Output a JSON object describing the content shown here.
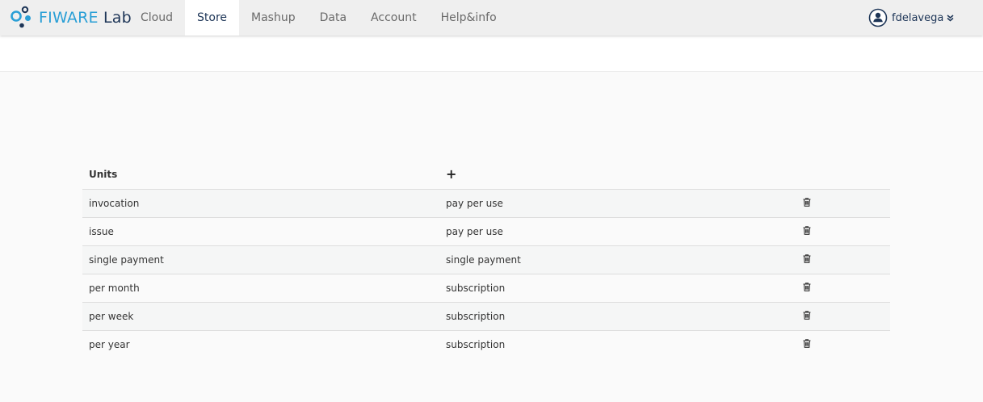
{
  "brand": {
    "name_part1": "FI",
    "name_part2": "WARE",
    "name_part3": " Lab",
    "icon": "fiware-logo-icon"
  },
  "nav": {
    "tabs": [
      {
        "label": "Cloud",
        "active": false
      },
      {
        "label": "Store",
        "active": true
      },
      {
        "label": "Mashup",
        "active": false
      },
      {
        "label": "Data",
        "active": false
      },
      {
        "label": "Account",
        "active": false
      },
      {
        "label": "Help&info",
        "active": false
      }
    ]
  },
  "user": {
    "name": "fdelavega",
    "icon": "user-circle-icon",
    "chevron": "double-chevron-down-icon"
  },
  "table": {
    "header_units": "Units",
    "add_label": "+",
    "rows": [
      {
        "unit": "invocation",
        "model": "pay per use"
      },
      {
        "unit": "issue",
        "model": "pay per use"
      },
      {
        "unit": "single payment",
        "model": "single payment"
      },
      {
        "unit": "per month",
        "model": "subscription"
      },
      {
        "unit": "per week",
        "model": "subscription"
      },
      {
        "unit": "per year",
        "model": "subscription"
      }
    ],
    "row_action_icon": "trash-icon"
  },
  "colors": {
    "brand_blue": "#2a9fd6",
    "brand_navy": "#1d3557",
    "nav_bg": "#efefef",
    "row_stripe": "#f5f6f6"
  }
}
